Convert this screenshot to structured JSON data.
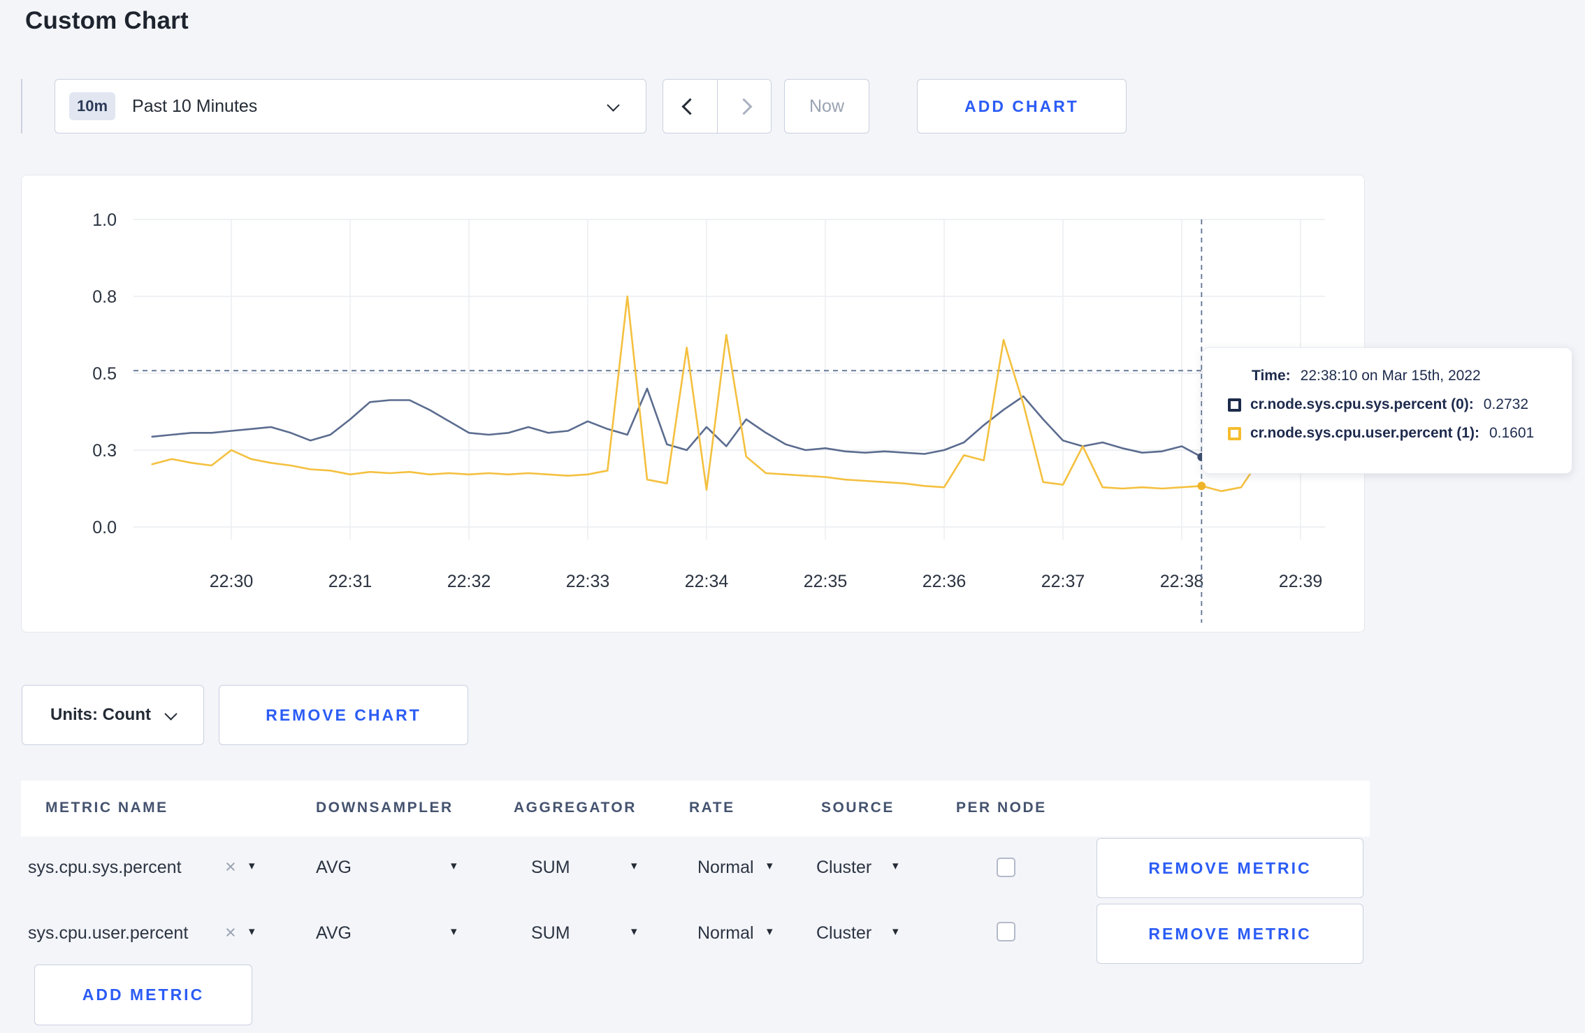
{
  "title": "Custom Chart",
  "time_selector": {
    "badge": "10m",
    "label": "Past 10 Minutes"
  },
  "nav": {
    "now_label": "Now"
  },
  "add_chart_label": "ADD CHART",
  "units": {
    "label": "Units: Count"
  },
  "remove_chart_label": "REMOVE CHART",
  "add_metric_label": "ADD METRIC",
  "icons": {
    "clear": "×",
    "dropdown": "▾"
  },
  "colors": {
    "accent_blue": "#2b5cf5",
    "page_background": "#f4f5f9",
    "series_sys": "#5b6c8f",
    "series_user": "#f4c03f",
    "crosshair": "#5d7292",
    "dark_text": "#242b35"
  },
  "chart_data": {
    "type": "line",
    "title": "",
    "ylabel": "",
    "xlabel": "",
    "y_tick_labels": [
      "0.0",
      "0.3",
      "0.5",
      "0.8",
      "1.0"
    ],
    "x_tick_labels": [
      "22:30",
      "22:31",
      "22:32",
      "22:33",
      "22:34",
      "22:35",
      "22:36",
      "22:37",
      "22:38",
      "22:39"
    ],
    "hline_value": 0.51,
    "hover_t": 490,
    "t_start": -40,
    "t_step": 10,
    "series": [
      {
        "name": "cr.node.sys.cpu.sys.percent",
        "color": "#5b6c8f",
        "dot_color": "#3d4d6e",
        "values": [
          0.335,
          0.34,
          0.345,
          0.345,
          0.35,
          0.355,
          0.36,
          0.345,
          0.325,
          0.34,
          0.38,
          0.425,
          0.43,
          0.43,
          0.405,
          0.375,
          0.345,
          0.34,
          0.345,
          0.36,
          0.345,
          0.35,
          0.375,
          0.355,
          0.34,
          0.46,
          0.315,
          0.3,
          0.36,
          0.31,
          0.38,
          0.345,
          0.315,
          0.3,
          0.305,
          0.295,
          0.29,
          0.295,
          0.29,
          0.285,
          0.3,
          0.32,
          0.365,
          0.405,
          0.44,
          0.38,
          0.325,
          0.31,
          0.32,
          0.305,
          0.29,
          0.295,
          0.31,
          0.2732,
          0.3,
          0.31,
          0.325,
          0.3,
          0.31,
          0.315
        ]
      },
      {
        "name": "cr.node.sys.cpu.user.percent",
        "color": "#f4c03f",
        "dot_color": "#f0b429",
        "values": [
          0.245,
          0.265,
          0.25,
          0.24,
          0.3,
          0.265,
          0.25,
          0.24,
          0.225,
          0.22,
          0.205,
          0.215,
          0.21,
          0.215,
          0.205,
          0.21,
          0.205,
          0.21,
          0.205,
          0.21,
          0.205,
          0.2,
          0.205,
          0.22,
          0.8,
          0.185,
          0.17,
          0.6,
          0.145,
          0.65,
          0.275,
          0.21,
          0.205,
          0.2,
          0.195,
          0.185,
          0.18,
          0.175,
          0.17,
          0.16,
          0.155,
          0.28,
          0.26,
          0.63,
          0.42,
          0.175,
          0.165,
          0.31,
          0.155,
          0.15,
          0.155,
          0.15,
          0.155,
          0.1601,
          0.14,
          0.155,
          0.27,
          0.285,
          0.27,
          0.22
        ]
      }
    ],
    "tooltip": {
      "time_label": "Time:",
      "time_value": "22:38:10 on Mar 15th, 2022",
      "series": [
        {
          "name": "cr.node.sys.cpu.sys.percent (0):",
          "value": "0.2732",
          "box_color": "#1c2b4a"
        },
        {
          "name": "cr.node.sys.cpu.user.percent (1):",
          "value": "0.1601",
          "box_color": "#f5bd2e"
        }
      ]
    }
  },
  "table": {
    "headers": [
      "METRIC NAME",
      "DOWNSAMPLER",
      "AGGREGATOR",
      "RATE",
      "SOURCE",
      "PER NODE"
    ],
    "remove_metric_label": "REMOVE METRIC",
    "rows": [
      {
        "metric": "sys.cpu.sys.percent",
        "downsampler": "AVG",
        "aggregator": "SUM",
        "rate": "Normal",
        "source": "Cluster",
        "per_node": false
      },
      {
        "metric": "sys.cpu.user.percent",
        "downsampler": "AVG",
        "aggregator": "SUM",
        "rate": "Normal",
        "source": "Cluster",
        "per_node": false
      }
    ]
  }
}
